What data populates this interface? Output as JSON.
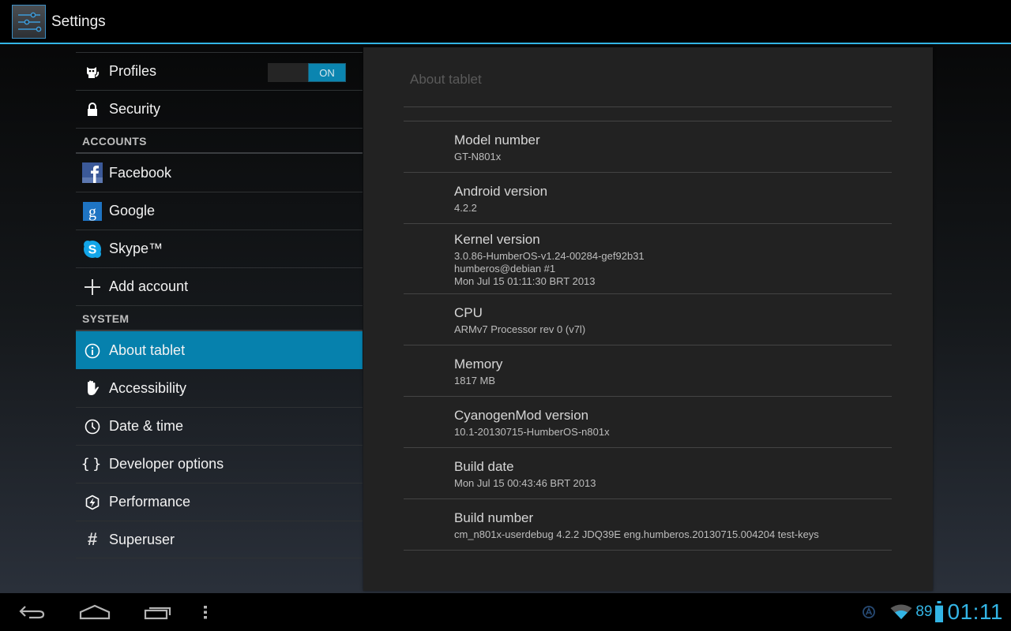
{
  "app": {
    "title": "Settings",
    "icon": "settings-sliders-icon"
  },
  "sidebar": {
    "items": [
      {
        "type": "item",
        "label": "Profiles",
        "icon": "profiles-icon",
        "toggle": "ON"
      },
      {
        "type": "item",
        "label": "Security",
        "icon": "lock-icon"
      },
      {
        "type": "header",
        "label": "ACCOUNTS"
      },
      {
        "type": "item",
        "label": "Facebook",
        "icon": "facebook-icon"
      },
      {
        "type": "item",
        "label": "Google",
        "icon": "google-icon"
      },
      {
        "type": "item",
        "label": "Skype™",
        "icon": "skype-icon"
      },
      {
        "type": "item",
        "label": "Add account",
        "icon": "plus-icon"
      },
      {
        "type": "header",
        "label": "SYSTEM"
      },
      {
        "type": "item",
        "label": "About tablet",
        "icon": "info-icon",
        "selected": true
      },
      {
        "type": "item",
        "label": "Accessibility",
        "icon": "hand-icon"
      },
      {
        "type": "item",
        "label": "Date & time",
        "icon": "clock-icon"
      },
      {
        "type": "item",
        "label": "Developer options",
        "icon": "braces-icon"
      },
      {
        "type": "item",
        "label": "Performance",
        "icon": "performance-icon"
      },
      {
        "type": "item",
        "label": "Superuser",
        "icon": "hash-icon"
      }
    ]
  },
  "panel": {
    "title": "About tablet",
    "items": [
      {
        "title": "Model number",
        "summary": "GT-N801x"
      },
      {
        "title": "Android version",
        "summary": "4.2.2"
      },
      {
        "title": "Kernel version",
        "summary": "3.0.86-HumberOS-v1.24-00284-gef92b31\nhumberos@debian #1\nMon Jul 15 01:11:30 BRT 2013"
      },
      {
        "title": "CPU",
        "summary": "ARMv7 Processor rev 0 (v7l)"
      },
      {
        "title": "Memory",
        "summary": "1817 MB"
      },
      {
        "title": "CyanogenMod version",
        "summary": "10.1-20130715-HumberOS-n801x"
      },
      {
        "title": "Build date",
        "summary": "Mon Jul 15 00:43:46 BRT 2013"
      },
      {
        "title": "Build number",
        "summary": "cm_n801x-userdebug 4.2.2 JDQ39E eng.humberos.20130715.004204 test-keys"
      }
    ]
  },
  "navbar": {
    "buttons": [
      "back-icon",
      "home-icon",
      "recent-apps-icon",
      "menu-icon"
    ]
  },
  "status": {
    "battery_percent": "89",
    "battery_level": 0.89,
    "time": "01:11",
    "accent": "#33b5e5"
  }
}
